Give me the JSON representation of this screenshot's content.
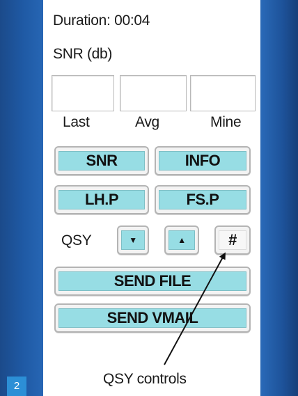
{
  "duration": {
    "label": "Duration:",
    "value": "00:04"
  },
  "snr": {
    "title": "SNR (db)",
    "fields": [
      {
        "label": "Last",
        "value": ""
      },
      {
        "label": "Avg",
        "value": ""
      },
      {
        "label": "Mine",
        "value": ""
      }
    ]
  },
  "buttons": {
    "snr": "SNR",
    "info": "INFO",
    "lhp": "LH.P",
    "fsp": "FS.P",
    "send_file": "SEND FILE",
    "send_vmail": "SEND VMAIL"
  },
  "qsy": {
    "label": "QSY",
    "down": "▼",
    "up": "▲",
    "hash": "#"
  },
  "callout": "QSY controls",
  "page_number": "2",
  "colors": {
    "button_face": "#97dde4",
    "side_panel": "#1f5aa5",
    "page_badge": "#2c8fd6"
  },
  "icons": {
    "down": "triangle-down-icon",
    "up": "triangle-up-icon"
  }
}
